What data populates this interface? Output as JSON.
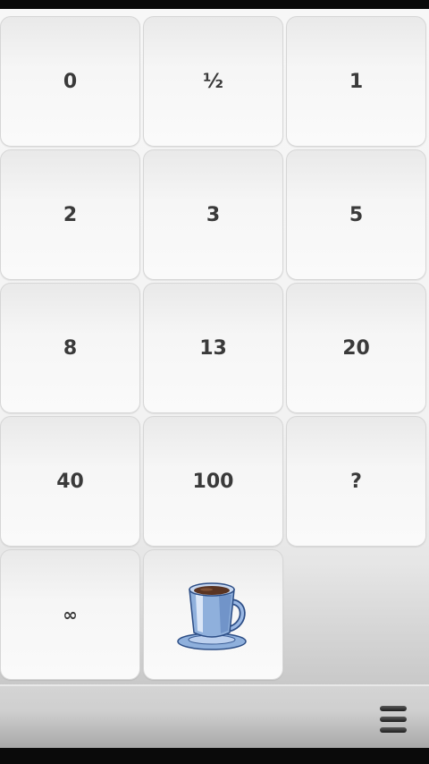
{
  "cards": [
    {
      "label": "0",
      "name": "card-0"
    },
    {
      "label": "½",
      "name": "card-half"
    },
    {
      "label": "1",
      "name": "card-1"
    },
    {
      "label": "2",
      "name": "card-2"
    },
    {
      "label": "3",
      "name": "card-3"
    },
    {
      "label": "5",
      "name": "card-5"
    },
    {
      "label": "8",
      "name": "card-8"
    },
    {
      "label": "13",
      "name": "card-13"
    },
    {
      "label": "20",
      "name": "card-20"
    },
    {
      "label": "40",
      "name": "card-40"
    },
    {
      "label": "100",
      "name": "card-100"
    },
    {
      "label": "?",
      "name": "card-question"
    },
    {
      "label": "∞",
      "name": "card-infinity"
    }
  ],
  "coffee_card": {
    "icon": "coffee-cup-icon"
  },
  "toolbar": {
    "menu_icon": "menu-icon"
  }
}
